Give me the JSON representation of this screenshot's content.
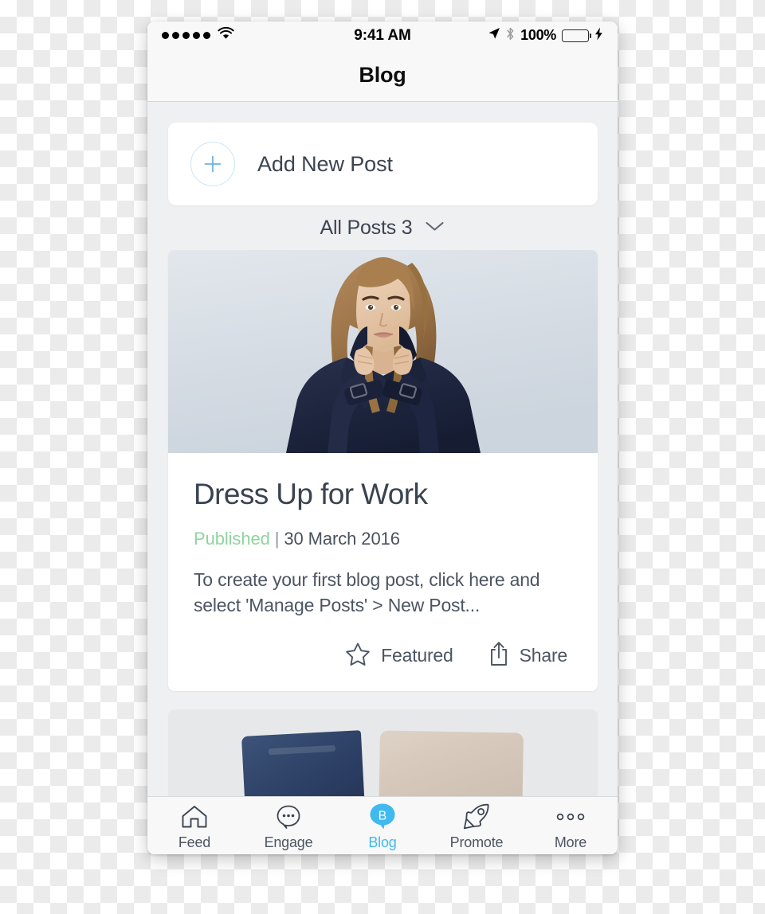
{
  "status_bar": {
    "carrier_dots": 5,
    "wifi_icon": "wifi-icon",
    "time": "9:41 AM",
    "location_icon": "location-arrow-icon",
    "bluetooth_icon": "bluetooth-icon",
    "battery_percent": "100%",
    "battery_level": 100,
    "charging_icon": "lightning-bolt-icon",
    "battery_color": "#5fd35f"
  },
  "nav": {
    "title": "Blog"
  },
  "add_post": {
    "icon": "plus-icon",
    "label": "Add New Post"
  },
  "filter": {
    "label": "All Posts 3",
    "chevron_icon": "chevron-down-icon"
  },
  "posts": [
    {
      "image_alt": "woman in navy trench coat",
      "title": "Dress Up for Work",
      "status": "Published",
      "separator": "|",
      "date": "30 March 2016",
      "excerpt": "To create your first blog post, click here and select 'Manage Posts' > New Post...",
      "actions": [
        {
          "icon": "star-outline-icon",
          "label": "Featured"
        },
        {
          "icon": "share-icon",
          "label": "Share"
        }
      ]
    },
    {
      "image_alt": "flat lay of jeans and beige top"
    }
  ],
  "tabs": [
    {
      "icon": "home-icon",
      "label": "Feed",
      "active": false
    },
    {
      "icon": "chat-bubble-icon",
      "label": "Engage",
      "active": false
    },
    {
      "icon": "blog-bubble-b-icon",
      "label": "Blog",
      "active": true
    },
    {
      "icon": "rocket-icon",
      "label": "Promote",
      "active": false
    },
    {
      "icon": "more-dots-icon",
      "label": "More",
      "active": false
    }
  ],
  "colors": {
    "accent_blue": "#3fb9ef",
    "published_green": "#8fd49f",
    "text_primary": "#3a4350",
    "content_bg": "#eff0f2",
    "chrome_bg": "#f8f8f8"
  }
}
